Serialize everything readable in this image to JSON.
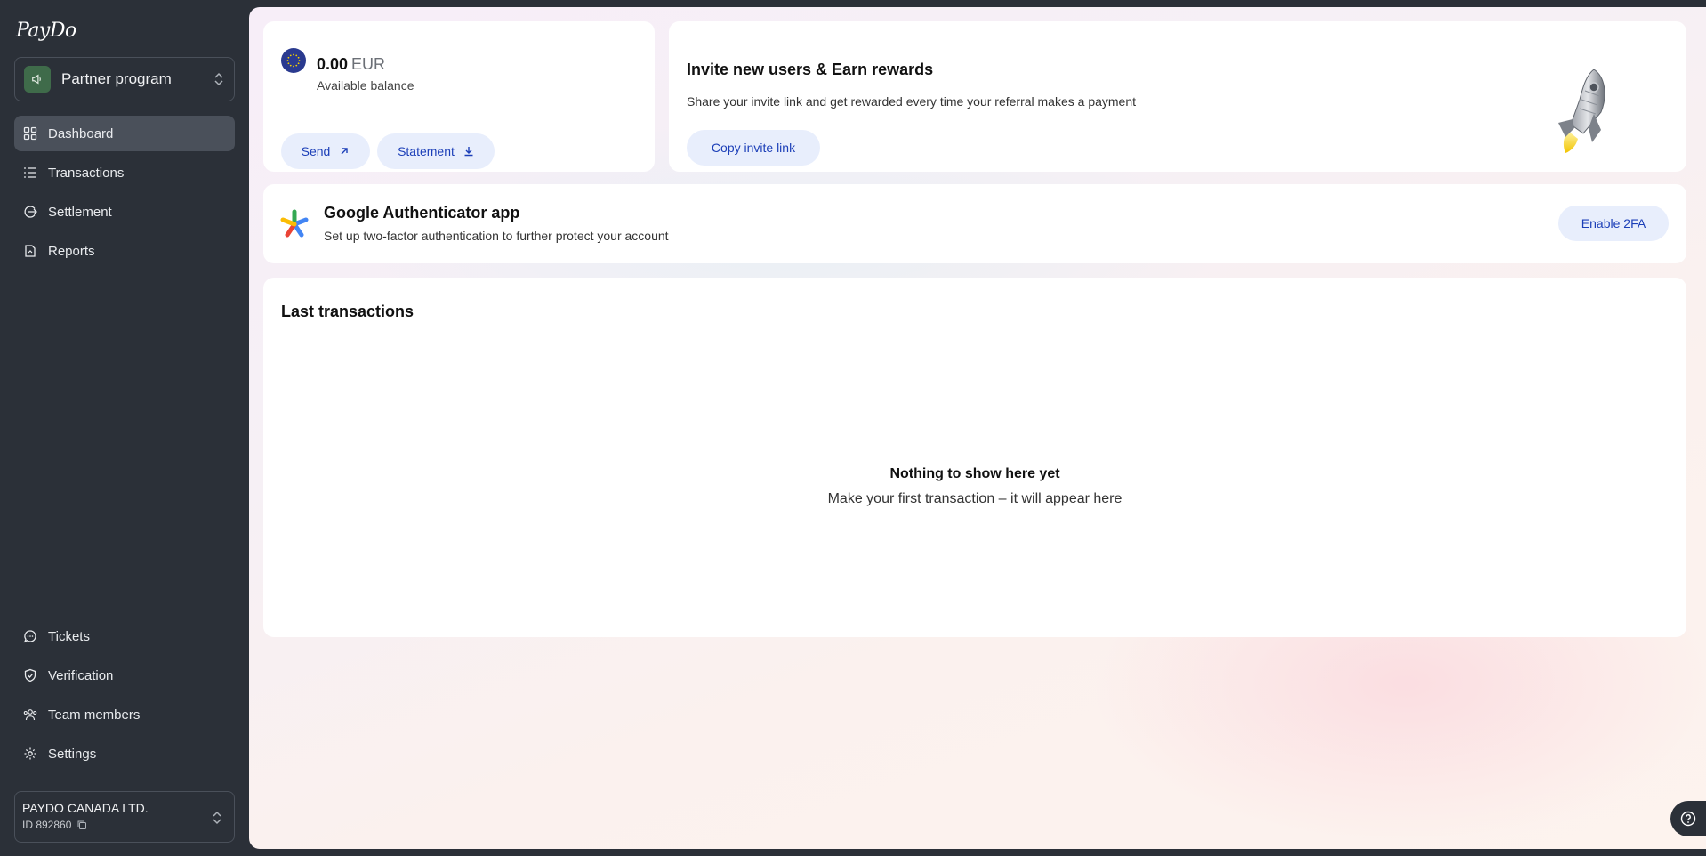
{
  "app": {
    "logo_text": "PayDo"
  },
  "sidebar": {
    "partner_select_label": "Partner program",
    "nav_top": [
      {
        "label": "Dashboard",
        "icon": "grid-icon",
        "active": true
      },
      {
        "label": "Transactions",
        "icon": "list-icon"
      },
      {
        "label": "Settlement",
        "icon": "settlement-icon"
      },
      {
        "label": "Reports",
        "icon": "report-icon"
      }
    ],
    "nav_bottom": [
      {
        "label": "Tickets",
        "icon": "chat-icon"
      },
      {
        "label": "Verification",
        "icon": "shield-check-icon"
      },
      {
        "label": "Team members",
        "icon": "users-icon"
      },
      {
        "label": "Settings",
        "icon": "gear-icon"
      }
    ],
    "company": {
      "name": "PAYDO CANADA LTD.",
      "id": "ID 892860"
    }
  },
  "balance": {
    "amount": "0.00",
    "currency": "EUR",
    "label": "Available balance",
    "send_label": "Send",
    "statement_label": "Statement"
  },
  "invite": {
    "title": "Invite new users & Earn rewards",
    "description": "Share your invite link and get rewarded every time your referral makes a payment",
    "button_label": "Copy invite link"
  },
  "authenticator": {
    "title": "Google Authenticator app",
    "description": "Set up two-factor authentication to further protect your account",
    "button_label": "Enable 2FA"
  },
  "transactions": {
    "title": "Last transactions",
    "empty_title": "Nothing to show here yet",
    "empty_description": "Make your first transaction – it will appear here"
  },
  "colors": {
    "sidebar_bg": "#2b3038",
    "active_nav_bg": "#4a505a",
    "accent_blue": "#1c3fb8",
    "pill_bg": "#e8eefc"
  }
}
